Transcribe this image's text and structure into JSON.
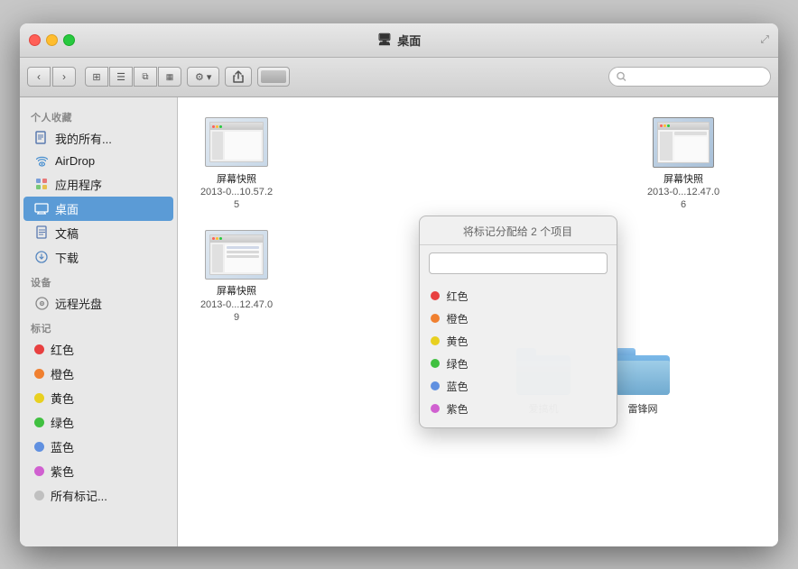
{
  "window": {
    "title": "桌面",
    "title_icon": "🖥"
  },
  "toolbar": {
    "back_label": "‹",
    "forward_label": "›",
    "view_icon_grid": "⊞",
    "view_icon_list": "☰",
    "view_icon_columns": "⊟",
    "view_icon_coverflow": "▦",
    "action_label": "操作",
    "action_dropdown": "▾",
    "share_icon": "↑",
    "search_placeholder": ""
  },
  "sidebar": {
    "section_personal": "个人收藏",
    "section_devices": "设备",
    "section_tags": "标记",
    "items_personal": [
      {
        "id": "all",
        "label": "我的所有...",
        "icon": "doc"
      },
      {
        "id": "airdrop",
        "label": "AirDrop",
        "icon": "airdrop"
      },
      {
        "id": "apps",
        "label": "应用程序",
        "icon": "apps"
      },
      {
        "id": "desktop",
        "label": "桌面",
        "icon": "desktop",
        "active": true
      },
      {
        "id": "docs",
        "label": "文稿",
        "icon": "docs"
      },
      {
        "id": "downloads",
        "label": "下载",
        "icon": "downloads"
      }
    ],
    "items_devices": [
      {
        "id": "remote-disc",
        "label": "远程光盘",
        "icon": "disc"
      }
    ],
    "items_tags": [
      {
        "id": "red",
        "label": "红色",
        "color": "#e84040"
      },
      {
        "id": "orange",
        "label": "橙色",
        "color": "#f08030"
      },
      {
        "id": "yellow",
        "label": "黄色",
        "color": "#e8d020"
      },
      {
        "id": "green",
        "label": "绿色",
        "color": "#40c040"
      },
      {
        "id": "blue",
        "label": "蓝色",
        "color": "#6090e0"
      },
      {
        "id": "purple",
        "label": "紫色",
        "color": "#d060d0"
      },
      {
        "id": "all-tags",
        "label": "所有标记...",
        "color": "#c0c0c0"
      }
    ]
  },
  "files": [
    {
      "id": "ss1",
      "type": "screenshot",
      "name": "屏幕快照",
      "date": "2013-0...10.57.25",
      "col": 1
    },
    {
      "id": "ss2",
      "type": "screenshot",
      "name": "屏幕快照",
      "date": "2013-0...12.47.09",
      "col": 1
    },
    {
      "id": "ss3",
      "type": "screenshot",
      "name": "屏幕快照",
      "date": "2013-0...12.47.06",
      "col": 3
    },
    {
      "id": "folder1",
      "type": "folder",
      "name": "爱搞机",
      "col": 2
    },
    {
      "id": "folder2",
      "type": "folder",
      "name": "雷锋网",
      "col": 2
    }
  ],
  "tag_popup": {
    "title": "将标记分配给 2 个项目",
    "search_placeholder": "",
    "items": [
      {
        "label": "红色",
        "color": "#e84040"
      },
      {
        "label": "橙色",
        "color": "#f08030"
      },
      {
        "label": "黄色",
        "color": "#e8d020"
      },
      {
        "label": "绿色",
        "color": "#40c040"
      },
      {
        "label": "蓝色",
        "color": "#6090e0"
      },
      {
        "label": "紫色",
        "color": "#d060d0"
      }
    ]
  }
}
